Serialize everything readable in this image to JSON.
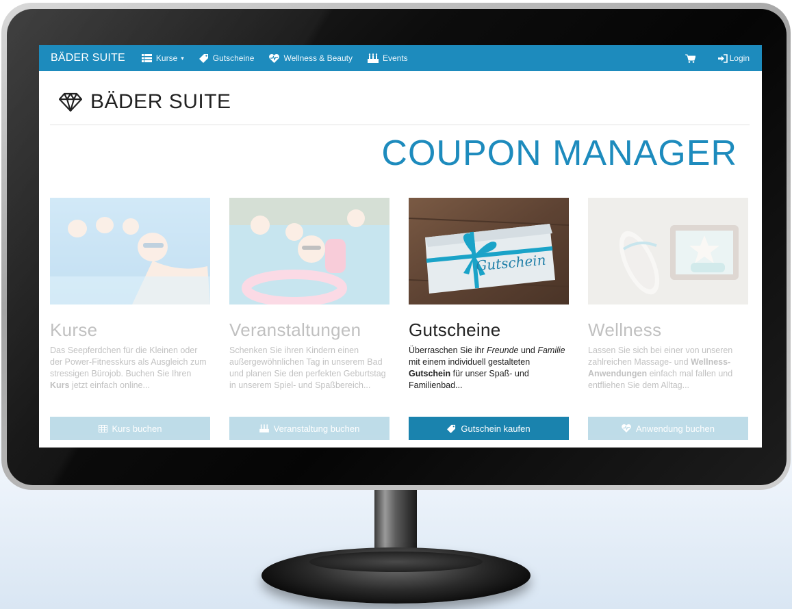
{
  "navbar": {
    "brand": "BÄDER SUITE",
    "items": [
      {
        "label": "Kurse",
        "icon": "list-icon",
        "dropdown": true
      },
      {
        "label": "Gutscheine",
        "icon": "tag-icon"
      },
      {
        "label": "Wellness & Beauty",
        "icon": "heartbeat-icon"
      },
      {
        "label": "Events",
        "icon": "birthday-cake-icon"
      }
    ],
    "cart_icon": "shopping-cart-icon",
    "login_label": "Login"
  },
  "header": {
    "logo_text": "BÄDER SUITE",
    "hero_title": "COUPON MANAGER"
  },
  "cards": [
    {
      "title": "Kurse",
      "text_before": "Das Seepferdchen für die Kleinen oder der Power-Fitnesskurs als Ausgleich zum stressigen Bürojob. Buchen Sie Ihren ",
      "text_bold": "Kurs",
      "text_after": " jetzt einfach online...",
      "button": "Kurs buchen",
      "button_icon": "table-icon"
    },
    {
      "title": "Veranstaltungen",
      "text": "Schenken Sie ihren Kindern einen außergewöhnlichen Tag in unserem Bad und planen Sie den perfekten Geburtstag in unserem Spiel- und Spaßbereich...",
      "button": "Veranstaltung buchen",
      "button_icon": "birthday-cake-icon"
    },
    {
      "title": "Gutscheine",
      "text_1": "Überraschen Sie ihr ",
      "text_italic_1": "Freunde",
      "text_2": " und ",
      "text_italic_2": "Familie",
      "text_3": " mit einem individuell gestalteten ",
      "text_bold": "Gutschein",
      "text_4": " für unser Spaß- und Familienbad...",
      "image_text": "Gutschein",
      "button": "Gutschein kaufen",
      "button_icon": "tag-icon"
    },
    {
      "title": "Wellness",
      "text_1": "Lassen Sie sich bei einer von unseren zahlreichen Massage- und ",
      "text_bold": "Wellness-Anwendungen",
      "text_2": " einfach mal fallen und entfliehen Sie dem Alltag...",
      "button": "Anwendung buchen",
      "button_icon": "heartbeat-icon"
    }
  ],
  "colors": {
    "accent": "#1d8bbd",
    "button": "#1a83ae"
  }
}
